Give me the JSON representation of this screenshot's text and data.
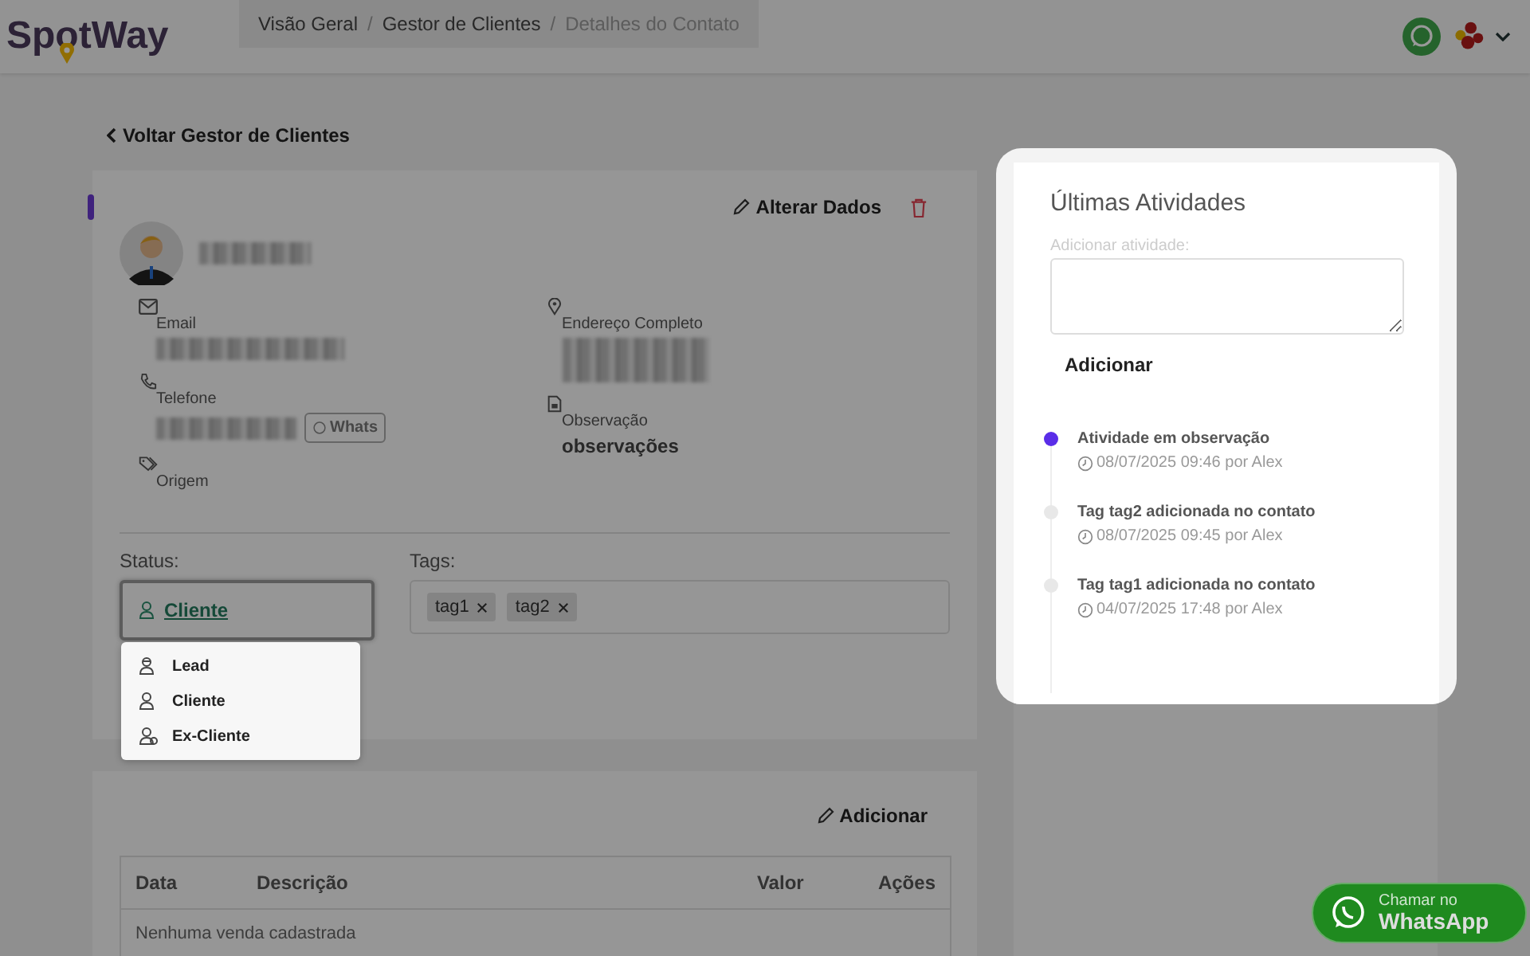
{
  "header": {
    "logo": "SpotWay",
    "separator": "/",
    "breadcrumb": [
      {
        "label": "Visão Geral",
        "current": false
      },
      {
        "label": "Gestor de Clientes",
        "current": false
      },
      {
        "label": "Detalhes do Contato",
        "current": true
      }
    ]
  },
  "back_link": "Voltar Gestor de Clientes",
  "contact": {
    "edit_button": "Alterar Dados",
    "fields": [
      {
        "kind": "email",
        "label": "Email"
      },
      {
        "kind": "address",
        "label": "Endereço Completo"
      },
      {
        "kind": "phone",
        "label": "Telefone",
        "action": "Whats"
      },
      {
        "kind": "note",
        "label": "Observação",
        "value": "observações"
      },
      {
        "kind": "origin",
        "label": "Origem"
      }
    ],
    "status": {
      "label": "Status:",
      "value": "Cliente",
      "expanded": true,
      "options": [
        {
          "kind": "lead",
          "label": "Lead"
        },
        {
          "kind": "client",
          "label": "Cliente"
        },
        {
          "kind": "ex",
          "label": "Ex-Cliente"
        }
      ]
    },
    "tags": {
      "label": "Tags:",
      "items": [
        "tag1",
        "tag2"
      ]
    }
  },
  "sales": {
    "add_button": "Adicionar",
    "table": {
      "columns": [
        "Data",
        "Descrição",
        "Valor",
        "Ações"
      ],
      "empty": "Nenhuma venda cadastrada"
    }
  },
  "activities": {
    "title": "Últimas Atividades",
    "input_label": "Adicionar atividade:",
    "add_button": "Adicionar",
    "items": [
      {
        "text": "Atividade em observação",
        "meta": "08/07/2025 09:46 por Alex",
        "active": true
      },
      {
        "text": "Tag tag2 adicionada no contato",
        "meta": "08/07/2025 09:45 por Alex",
        "active": false
      },
      {
        "text": "Tag tag1 adicionada no contato",
        "meta": "04/07/2025 17:48 por Alex",
        "active": false
      }
    ]
  },
  "whatsapp_button": {
    "line_1": "Chamar no",
    "line_2": "WhatsApp"
  }
}
